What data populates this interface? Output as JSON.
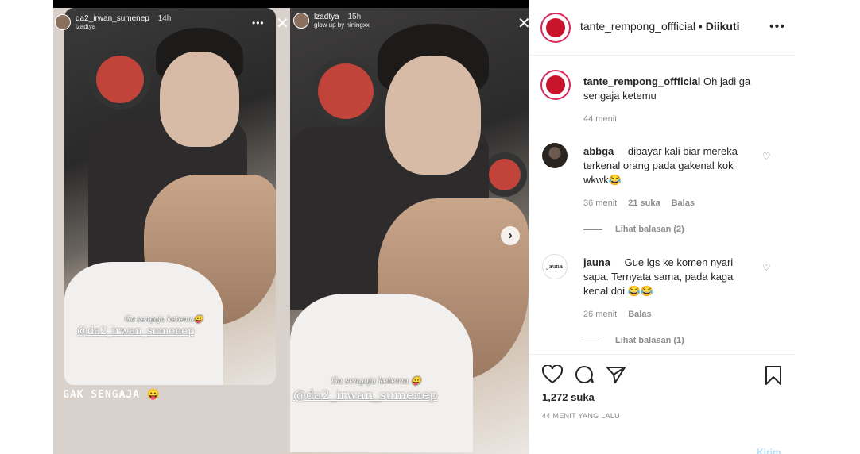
{
  "story_left": {
    "username": "da2_irwan_sumenep",
    "time": "14h",
    "sub": "lzadtya",
    "small_caption": "Ga sengaja ketemu😛",
    "mention": "@da2_irwan_sumenep",
    "big_caption": "GAK SENGAJA 😛"
  },
  "story_right": {
    "username": "lzadtya",
    "time": "15h",
    "sub": "glow up by niningxx",
    "small_caption": "Ga sengaja ketemu 😛",
    "mention": "@da2_irwan_sumenep"
  },
  "header": {
    "username": "tante_rempong_offficial",
    "separator": " • ",
    "follow": "Diikuti",
    "more": "•••"
  },
  "caption": {
    "username": "tante_rempong_offficial",
    "text": "Oh jadi ga sengaja ketemu",
    "time": "44 menit"
  },
  "comments": [
    {
      "username": "abbga",
      "text": "dibayar kali biar mereka terkenal orang pada gakenal kok wkwk😂",
      "time": "36 menit",
      "likes": "21 suka",
      "reply": "Balas",
      "view_replies": "Lihat balasan (2)"
    },
    {
      "username": "jauna",
      "text": "Gue lgs ke komen nyari sapa. Ternyata sama, pada kaga kenal doi 😂😂",
      "time": "26 menit",
      "reply": "Balas",
      "view_replies": "Lihat balasan (1)"
    }
  ],
  "likes": "1,272 suka",
  "posted": "44 MENIT YANG LALU",
  "send": "Kirim",
  "colors": {
    "accent": "#0095f6",
    "brand": "#c8152c",
    "meta": "#8e8e8e",
    "text": "#262626"
  }
}
